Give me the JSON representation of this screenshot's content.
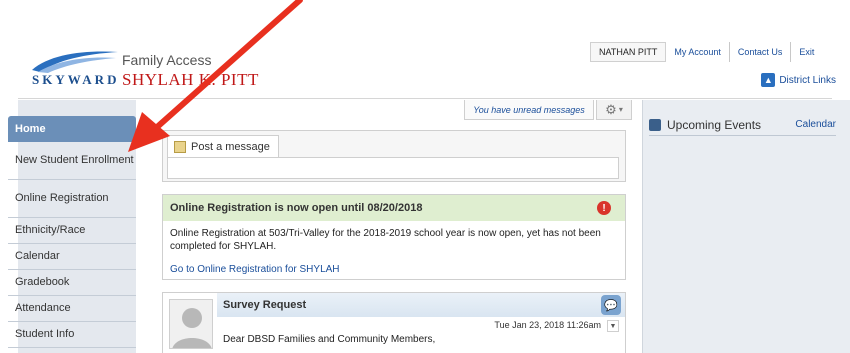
{
  "header": {
    "logo_text": "SKYWARD",
    "app_name": "Family Access",
    "student_name": "SHYLAH K. PITT",
    "user_name": "NATHAN PITT",
    "my_account": "My Account",
    "contact_us": "Contact Us",
    "exit": "Exit",
    "district_links": "District Links"
  },
  "sidebar": {
    "items": [
      "Home",
      "New Student Enrollment",
      "Online Registration",
      "Ethnicity/Race",
      "Calendar",
      "Gradebook",
      "Attendance",
      "Student Info"
    ],
    "active": "Home"
  },
  "messages": {
    "unread": "You have unread messages"
  },
  "post": {
    "tab_label": "Post a message"
  },
  "registration": {
    "title": "Online Registration is now open until 08/20/2018",
    "body": "Online Registration at 503/Tri-Valley for the 2018-2019 school year is now open, yet has not been completed for SHYLAH.",
    "link": "Go to Online Registration for SHYLAH"
  },
  "survey": {
    "title": "Survey Request",
    "date": "Tue Jan 23, 2018 11:26am",
    "text": "Dear DBSD Families and Community Members,"
  },
  "events": {
    "title": "Upcoming Events",
    "calendar_link": "Calendar"
  },
  "colors": {
    "accent_blue": "#1a4e9a",
    "name_red": "#c01818",
    "arrow_red": "#e8301f",
    "home_tab": "#6b8fb8"
  }
}
